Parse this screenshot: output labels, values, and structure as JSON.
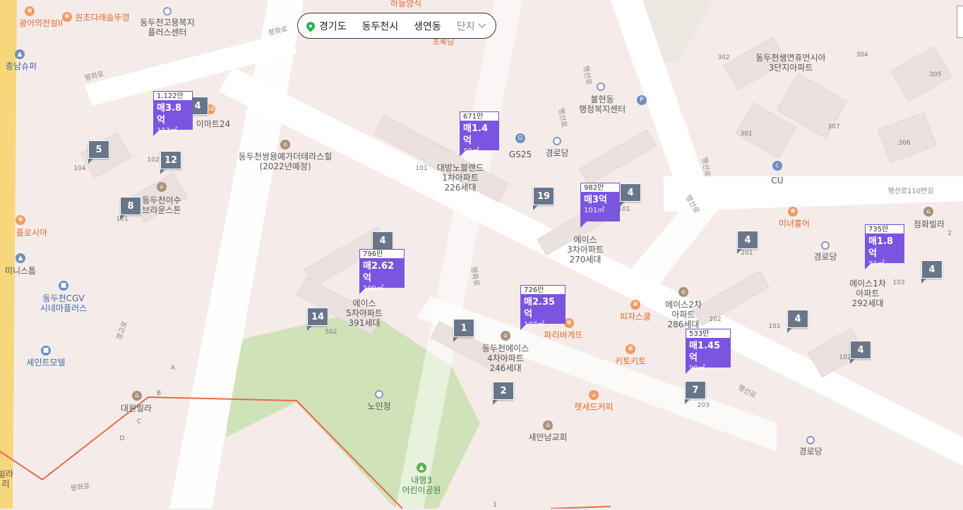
{
  "location_bar": {
    "province": "경기도",
    "city": "동두천시",
    "dong": "생연동",
    "complex_placeholder": "단지",
    "icons": [
      "location-pin-icon",
      "chevron-down-icon"
    ]
  },
  "price_markers": [
    {
      "id": "a",
      "unit_price": "1,122만",
      "price": "매3.8억",
      "area": "112㎡"
    },
    {
      "id": "b",
      "unit_price": "671만",
      "price": "매1.4억",
      "area": "69㎡"
    },
    {
      "id": "c",
      "unit_price": "982만",
      "price": "매3억",
      "area": "101㎡"
    },
    {
      "id": "d",
      "unit_price": "796만",
      "price": "매2.62억",
      "area": "109㎡"
    },
    {
      "id": "e",
      "unit_price": "726만",
      "price": "매2.35억",
      "area": "107㎡"
    },
    {
      "id": "f",
      "unit_price": "533만",
      "price": "매1.45억",
      "area": "90㎡"
    },
    {
      "id": "g",
      "unit_price": "735만",
      "price": "매1.8억",
      "area": "81㎡"
    }
  ],
  "count_markers": [
    "4",
    "5",
    "12",
    "8",
    "4",
    "19",
    "4",
    "14",
    "1",
    "2",
    "4",
    "4",
    "4",
    "7",
    "4"
  ],
  "labels": {
    "t1": "광어의전설II",
    "t2": "원조다래솔뚜껑",
    "t3": "동두천고용복지\n플러스센터",
    "t4": "하늘양식",
    "t5": "평화로",
    "t6": "충남슈퍼",
    "t7": "평화로",
    "t8": "이마트24",
    "t9": "동두천쌍용예가더테라스힐\n(2022년예정)",
    "t10": "대방노블랜드\n1차아파트\n226세대",
    "t11": "GS25",
    "t12": "경로당",
    "t13": "불현동\n행정복지센터",
    "t14": "동두천생연휴먼시아\n3단지아파트",
    "t15": "CU",
    "t16": "행선로110번길",
    "t17": "동두천이수\n브라운스톤",
    "t18": "플로시아",
    "t19": "미니스톱",
    "t20": "동두천CGV\n시네마플러스",
    "t21": "세인트모텔",
    "t22": "에이스\n3차아파트\n270세대",
    "t23": "미녀흉어",
    "t24": "정화빌라",
    "t25": "경로당",
    "t26": "에이스1차\n아파트\n292세대",
    "t27": "에이스\n5차아파트\n391세대",
    "t28": "에이스2차\n아파트\n286세대",
    "t29": "피자스쿨",
    "t30": "파리바게뜨",
    "t31": "동두천에이스\n4차아파트\n246세대",
    "t32": "키토키토",
    "t33": "헷세드커피",
    "t34": "새만남교회",
    "t35": "노인정",
    "t36": "내행3\n어린이공원",
    "t37": "대원빌라",
    "t38": "경로당",
    "t39": "평화로",
    "t40": "행선로",
    "t41": "행선로",
    "t42": "행선로",
    "t43": "행선로",
    "t44": "행선로",
    "t45": "경고로",
    "t46": "초록님",
    "t47": "평화로",
    "t48": "빌라\n리"
  },
  "building_numbers": [
    "104",
    "102",
    "101",
    "101",
    "302",
    "304",
    "305",
    "301",
    "307",
    "306",
    "101",
    "201",
    "103",
    "502",
    "202",
    "101",
    "102",
    "203",
    "2",
    "1",
    "A",
    "B",
    "C",
    "D"
  ],
  "colors": {
    "price_marker": "#7b55e0",
    "count_marker": "#69768a",
    "park": "#cfe2b8",
    "road": "#ffffff",
    "boundary": "#e8694a"
  }
}
